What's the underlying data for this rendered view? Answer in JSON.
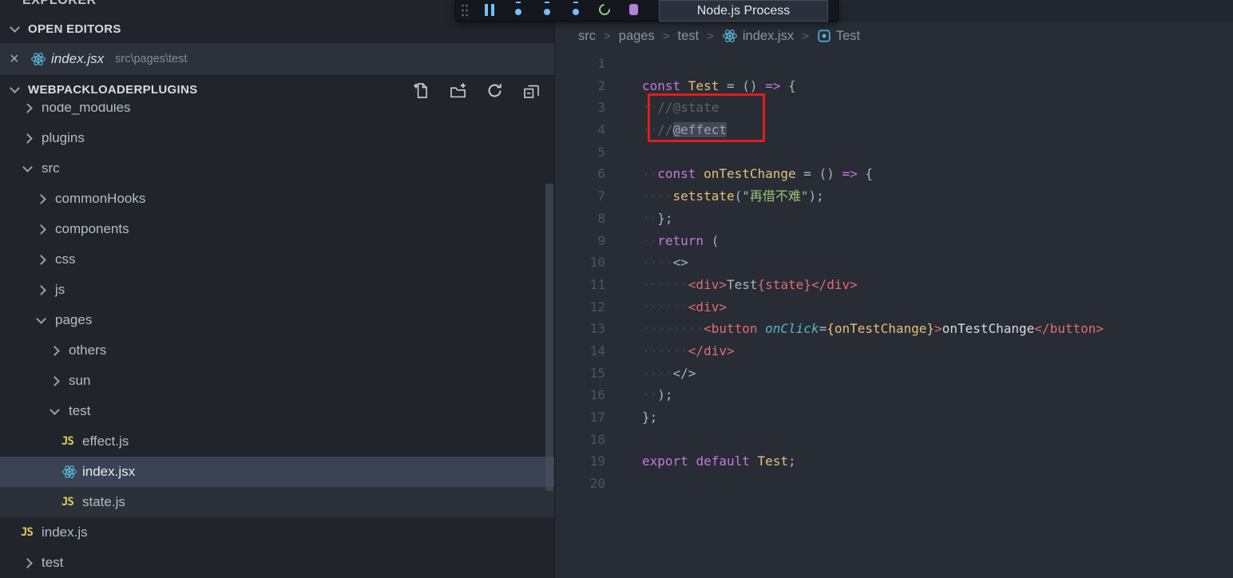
{
  "debug_toolbar": {
    "buttons": [
      {
        "name": "pause",
        "color": "#75beff"
      },
      {
        "name": "step-over",
        "color": "#75beff"
      },
      {
        "name": "step-into",
        "color": "#75beff"
      },
      {
        "name": "step-out",
        "color": "#75beff"
      },
      {
        "name": "restart",
        "color": "#89d185"
      },
      {
        "name": "disconnect",
        "color": "#b180d7"
      }
    ],
    "process_selector": "Node.js Process"
  },
  "sidebar": {
    "explorer_label": "EXPLORER",
    "open_editors": {
      "header": "OPEN EDITORS",
      "items": [
        {
          "name": "index.jsx",
          "path": "src\\pages\\test",
          "icon": "react"
        }
      ]
    },
    "project": {
      "header": "WEBPACKLOADERPLUGINS",
      "actions": [
        "new-file",
        "new-folder",
        "refresh-explorer",
        "collapse-folders"
      ],
      "tree": [
        {
          "label": "node_modules",
          "kind": "folder",
          "level": 0,
          "expanded": false,
          "clipped": true
        },
        {
          "label": "plugins",
          "kind": "folder",
          "level": 0,
          "expanded": false
        },
        {
          "label": "src",
          "kind": "folder",
          "level": 0,
          "expanded": true
        },
        {
          "label": "commonHooks",
          "kind": "folder",
          "level": 1,
          "expanded": false
        },
        {
          "label": "components",
          "kind": "folder",
          "level": 1,
          "expanded": false
        },
        {
          "label": "css",
          "kind": "folder",
          "level": 1,
          "expanded": false
        },
        {
          "label": "js",
          "kind": "folder",
          "level": 1,
          "expanded": false
        },
        {
          "label": "pages",
          "kind": "folder",
          "level": 1,
          "expanded": true
        },
        {
          "label": "others",
          "kind": "folder",
          "level": 2,
          "expanded": false
        },
        {
          "label": "sun",
          "kind": "folder",
          "level": 2,
          "expanded": false
        },
        {
          "label": "test",
          "kind": "folder",
          "level": 2,
          "expanded": true
        },
        {
          "label": "effect.js",
          "kind": "file",
          "level": 3,
          "icon": "js"
        },
        {
          "label": "index.jsx",
          "kind": "file",
          "level": 3,
          "icon": "react",
          "selected": true
        },
        {
          "label": "state.js",
          "kind": "file",
          "level": 3,
          "icon": "js",
          "subtle": true
        },
        {
          "label": "index.js",
          "kind": "file",
          "level": 0,
          "icon": "js"
        },
        {
          "label": "test",
          "kind": "folder",
          "level": 0,
          "expanded": false
        }
      ]
    }
  },
  "breadcrumb": {
    "items": [
      {
        "label": "src"
      },
      {
        "label": "pages"
      },
      {
        "label": "test"
      },
      {
        "label": "index.jsx",
        "icon": "react"
      },
      {
        "label": "Test",
        "icon": "symbol-module"
      }
    ]
  },
  "editor": {
    "lines": [
      {
        "n": 1,
        "tokens": []
      },
      {
        "n": 2,
        "tokens": [
          [
            "kw",
            "const "
          ],
          [
            "fn",
            "Test"
          ],
          [
            "pn",
            " = () "
          ],
          [
            "arw",
            "=>"
          ],
          [
            "pn",
            " {"
          ]
        ]
      },
      {
        "n": 3,
        "tokens": [
          [
            "ws",
            "··"
          ],
          [
            "cm",
            "//@state"
          ]
        ]
      },
      {
        "n": 4,
        "tokens": [
          [
            "ws",
            "··"
          ],
          [
            "cm",
            "//"
          ],
          [
            "cmhl",
            "@effect"
          ]
        ]
      },
      {
        "n": 5,
        "tokens": []
      },
      {
        "n": 6,
        "tokens": [
          [
            "ws",
            "··"
          ],
          [
            "kw",
            "const "
          ],
          [
            "fn",
            "onTestChange"
          ],
          [
            "pn",
            " = () "
          ],
          [
            "arw",
            "=>"
          ],
          [
            "pn",
            " {"
          ]
        ]
      },
      {
        "n": 7,
        "tokens": [
          [
            "ws",
            "····"
          ],
          [
            "fn",
            "setstate"
          ],
          [
            "pn",
            "("
          ],
          [
            "str",
            "\"再借不难\""
          ],
          [
            "pn",
            ");"
          ]
        ]
      },
      {
        "n": 8,
        "tokens": [
          [
            "ws",
            "··"
          ],
          [
            "pn",
            "};"
          ]
        ]
      },
      {
        "n": 9,
        "tokens": [
          [
            "ws",
            "··"
          ],
          [
            "kw",
            "return"
          ],
          [
            "pn",
            " ("
          ]
        ]
      },
      {
        "n": 10,
        "tokens": [
          [
            "ws",
            "····"
          ],
          [
            "pn",
            "<>"
          ]
        ]
      },
      {
        "n": 11,
        "tokens": [
          [
            "ws",
            "······"
          ],
          [
            "tag",
            "<div>"
          ],
          [
            "txt",
            "Test"
          ],
          [
            "varj",
            "{state}"
          ],
          [
            "tag",
            "</div>"
          ]
        ]
      },
      {
        "n": 12,
        "tokens": [
          [
            "ws",
            "······"
          ],
          [
            "tag",
            "<div>"
          ]
        ]
      },
      {
        "n": 13,
        "tokens": [
          [
            "ws",
            "········"
          ],
          [
            "tag",
            "<button "
          ],
          [
            "attr",
            "onClick"
          ],
          [
            "pn",
            "="
          ],
          [
            "fnref",
            "{onTestChange}"
          ],
          [
            "tag",
            ">"
          ],
          [
            "txtb",
            "onTestChange"
          ],
          [
            "tag",
            "</button>"
          ]
        ]
      },
      {
        "n": 14,
        "tokens": [
          [
            "ws",
            "······"
          ],
          [
            "tag",
            "</div>"
          ]
        ]
      },
      {
        "n": 15,
        "tokens": [
          [
            "ws",
            "····"
          ],
          [
            "pn",
            "</>"
          ]
        ]
      },
      {
        "n": 16,
        "tokens": [
          [
            "ws",
            "··"
          ],
          [
            "pn",
            ");"
          ]
        ]
      },
      {
        "n": 17,
        "tokens": [
          [
            "pn",
            "};"
          ]
        ]
      },
      {
        "n": 18,
        "tokens": []
      },
      {
        "n": 19,
        "tokens": [
          [
            "kw",
            "export "
          ],
          [
            "kw",
            "default "
          ],
          [
            "fn",
            "Test"
          ],
          [
            "pn",
            ";"
          ]
        ]
      },
      {
        "n": 20,
        "tokens": []
      }
    ]
  },
  "annotation": {
    "type": "red-rectangle",
    "color": "#e11d1d"
  }
}
